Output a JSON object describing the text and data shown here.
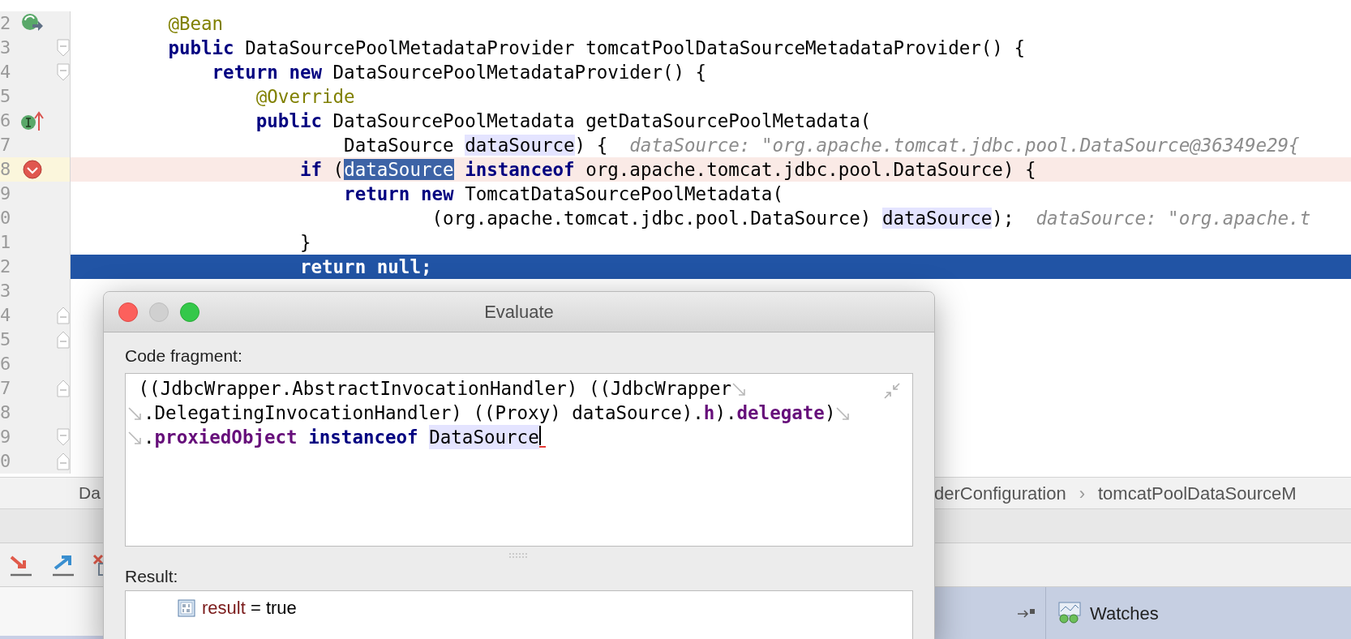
{
  "editor": {
    "lines": [
      {
        "number": "2",
        "kind": "normal",
        "marker": {
          "kind": "bean"
        },
        "segments": [
          {
            "text": "        @Bean",
            "kind": "annotation"
          }
        ]
      },
      {
        "number": "3",
        "kind": "normal",
        "fold": {
          "kind": "start"
        },
        "segments": [
          {
            "text": "        public",
            "kind": "keyword"
          },
          {
            "text": " DataSourcePoolMetadataProvider tomcatPoolDataSourceMetadataProvider() {",
            "kind": "plain"
          }
        ]
      },
      {
        "number": "4",
        "kind": "normal",
        "fold": {
          "kind": "start"
        },
        "segments": [
          {
            "text": "            return",
            "kind": "keyword"
          },
          {
            "text": " new",
            "kind": "keyword"
          },
          {
            "text": " DataSourcePoolMetadataProvider() {",
            "kind": "plain"
          }
        ]
      },
      {
        "number": "5",
        "kind": "normal",
        "segments": [
          {
            "text": "                @Override",
            "kind": "annotation"
          }
        ]
      },
      {
        "number": "6",
        "kind": "normal",
        "marker": {
          "kind": "implements"
        },
        "segments": [
          {
            "text": "                public",
            "kind": "keyword"
          },
          {
            "text": " DataSourcePoolMetadata getDataSourcePoolMetadata(",
            "kind": "plain"
          }
        ]
      },
      {
        "number": "7",
        "kind": "normal",
        "segments": [
          {
            "text": "                        DataSource",
            "kind": "plain"
          },
          {
            "text": " dataSource",
            "kind": "usage"
          },
          {
            "text": ") {",
            "kind": "plain"
          },
          {
            "text": "  dataSource: \"org.apache.tomcat.jdbc.pool.DataSource@36349e29{",
            "kind": "hint"
          }
        ]
      },
      {
        "number": "8",
        "kind": "breakpoint",
        "marker": {
          "kind": "breakpoint"
        },
        "segments": [
          {
            "text": "                    if",
            "kind": "keyword"
          },
          {
            "text": " (",
            "kind": "plain"
          },
          {
            "text": "dataSource",
            "kind": "selected"
          },
          {
            "text": " instanceof",
            "kind": "keyword"
          },
          {
            "text": " org.apache.tomcat.jdbc.pool.DataSource) {",
            "kind": "plain"
          }
        ]
      },
      {
        "number": "9",
        "kind": "normal",
        "segments": [
          {
            "text": "                        return",
            "kind": "keyword"
          },
          {
            "text": " new",
            "kind": "keyword"
          },
          {
            "text": " TomcatDataSourcePoolMetadata(",
            "kind": "plain"
          }
        ]
      },
      {
        "number": "0",
        "kind": "normal",
        "segments": [
          {
            "text": "                                (org.apache.tomcat.jdbc.pool.DataSource)",
            "kind": "plain"
          },
          {
            "text": " dataSource",
            "kind": "usage"
          },
          {
            "text": ");",
            "kind": "plain"
          },
          {
            "text": "  dataSource: \"org.apache.t",
            "kind": "hint"
          }
        ]
      },
      {
        "number": "1",
        "kind": "normal",
        "segments": [
          {
            "text": "                    }",
            "kind": "plain"
          }
        ]
      },
      {
        "number": "2",
        "kind": "execution",
        "segments": [
          {
            "text": "                    return",
            "kind": "keyword"
          },
          {
            "text": " null",
            "kind": "keyword"
          },
          {
            "text": ";",
            "kind": "plain"
          }
        ]
      },
      {
        "number": "3",
        "kind": "normal"
      },
      {
        "number": "4",
        "kind": "normal",
        "fold": {
          "kind": "end"
        }
      },
      {
        "number": "5",
        "kind": "normal",
        "fold": {
          "kind": "end"
        }
      },
      {
        "number": "6",
        "kind": "normal"
      },
      {
        "number": "7",
        "kind": "normal",
        "fold": {
          "kind": "end"
        }
      },
      {
        "number": "8",
        "kind": "normal"
      },
      {
        "number": "9",
        "kind": "normal",
        "fold": {
          "kind": "start"
        }
      },
      {
        "number": "0",
        "kind": "normal",
        "fold": {
          "kind": "end"
        }
      }
    ]
  },
  "breadcrumbs": {
    "separator": "›",
    "items": [
      {
        "label": "Da"
      },
      {
        "label": "derConfiguration"
      },
      {
        "label": "tomcatPoolDataSourceM"
      }
    ]
  },
  "dialog": {
    "title": "Evaluate",
    "code_label": "Code fragment:",
    "code_lines": [
      {
        "wrapped_start": false,
        "wrapped_end": true,
        "caret": false,
        "segments": [
          {
            "text": " ((JdbcWrapper.AbstractInvocationHandler) ((JdbcWrapper",
            "kind": "plain"
          }
        ]
      },
      {
        "wrapped_start": true,
        "wrapped_end": true,
        "caret": false,
        "segments": [
          {
            "text": ".DelegatingInvocationHandler) ((Proxy) dataSource).",
            "kind": "plain"
          },
          {
            "text": "h",
            "kind": "field"
          },
          {
            "text": ").",
            "kind": "plain"
          },
          {
            "text": "delegate",
            "kind": "field"
          },
          {
            "text": ")",
            "kind": "plain"
          }
        ]
      },
      {
        "wrapped_start": true,
        "wrapped_end": false,
        "caret": true,
        "segments": [
          {
            "text": ".",
            "kind": "plain"
          },
          {
            "text": "proxiedObject",
            "kind": "field"
          },
          {
            "text": " instanceof",
            "kind": "keyword"
          },
          {
            "text": " DataSource",
            "kind": "usage"
          }
        ]
      }
    ],
    "result_label": "Result:",
    "result": {
      "name": "result",
      "operator": "=",
      "value": "true"
    }
  },
  "watches_tab": {
    "label": "Watches"
  }
}
